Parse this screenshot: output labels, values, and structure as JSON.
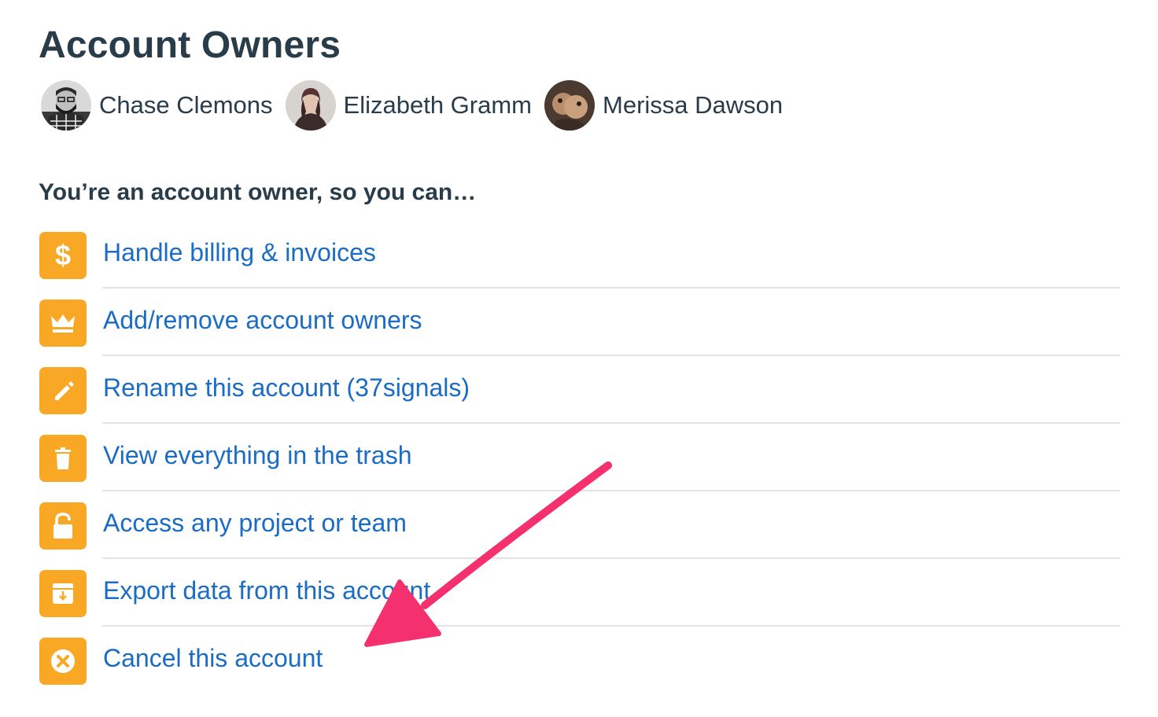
{
  "header": {
    "title": "Account Owners"
  },
  "owners": [
    {
      "name": "Chase Clemons"
    },
    {
      "name": "Elizabeth Gramm"
    },
    {
      "name": "Merissa Dawson"
    }
  ],
  "permissions": {
    "heading": "You’re an account owner, so you can…",
    "items": [
      {
        "label": "Handle billing & invoices",
        "icon": "dollar-icon"
      },
      {
        "label": "Add/remove account owners",
        "icon": "crown-icon"
      },
      {
        "label": "Rename this account (37signals)",
        "icon": "pencil-icon"
      },
      {
        "label": "View everything in the trash",
        "icon": "trash-icon"
      },
      {
        "label": "Access any project or team",
        "icon": "unlock-icon"
      },
      {
        "label": "Export data from this account",
        "icon": "export-icon"
      },
      {
        "label": "Cancel this account",
        "icon": "cancel-icon"
      }
    ]
  },
  "colors": {
    "accent": "#f9a825",
    "link": "#1a6cc4",
    "heading": "#283c4a",
    "annotation_arrow": "#f5306e"
  }
}
